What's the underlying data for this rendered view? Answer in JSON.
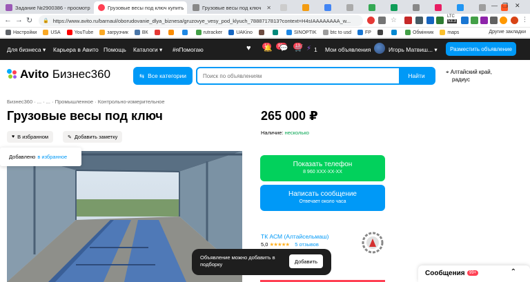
{
  "browser": {
    "tabs": [
      {
        "label": "Задание №2900386 - просмотр",
        "favicon_color": "#9b59b6",
        "active": false
      },
      {
        "label": "Грузовые весы под ключ купить",
        "favicon_color": "#ff4053",
        "active": true
      },
      {
        "label": "Грузовые весы под ключ",
        "favicon_color": "#888888",
        "active": false
      }
    ],
    "url": "https://www.avito.ru/barnaul/oborudovanie_dlya_biznesa/gruzovye_vesy_pod_klyuch_7888717813?context=H4sIAAAAAAAA_w...",
    "bookmarks": [
      "Настройки",
      "USA",
      "YouTube",
      "загрузчик",
      "ВК",
      "",
      "",
      "",
      "rutracker",
      "UAKino",
      "",
      "",
      "SINOPTIK",
      "btc to usd",
      "FP",
      "",
      "",
      "Обмінник",
      "maps"
    ],
    "other_bookmarks": "Другие закладки",
    "ext_badges": {
      "ltc": "LTC",
      "ltc_val": "53.3",
      "count": "50"
    }
  },
  "topnav": {
    "business": "Для бизнеса",
    "career": "Карьера в Авито",
    "help": "Помощь",
    "catalogs": "Каталоги",
    "hashtag": "#яПомогаю",
    "fav_badge": "14",
    "notif_badge": "99+",
    "cart_badge": "13",
    "wallet": "1",
    "my_ads": "Мои объявления",
    "user": "Игорь Матвиш...",
    "post_btn": "Разместить объявление"
  },
  "header": {
    "logo_avito": "Avito",
    "logo_b360": "Бизнес360",
    "categories_btn": "Все категории",
    "search_placeholder": "Поиск по объявлениям",
    "search_btn": "Найти",
    "location": "Алтайский край,",
    "location2": "радиус"
  },
  "listing": {
    "breadcrumbs": "Бизнес360  ·  ...  ·  ...  ·  Промышленное  ·  Контрольно-измерительное",
    "title": "Грузовые весы под ключ",
    "price": "265 000 ₽",
    "availability_label": "Наличие:",
    "availability_value": "несколько",
    "fav_btn": "В избранном",
    "note_btn": "Добавить заметку",
    "fav_toast": "Добавлено",
    "fav_toast_link": "в избранное"
  },
  "contact": {
    "phone_btn": "Показать телефон",
    "phone_masked": "8 960 XXX-XX-XX",
    "message_btn": "Написать сообщение",
    "message_sub": "Отвечает около часа",
    "seller": "ТК АСМ (Алтайсельмаш)",
    "rating": "5,0",
    "stars": "★★★★★",
    "reviews": "5 отзывов"
  },
  "toast": {
    "text": "Объявление можно добавить в подборку",
    "button": "Добавить"
  },
  "messages": {
    "label": "Сообщения",
    "count": "99+"
  }
}
